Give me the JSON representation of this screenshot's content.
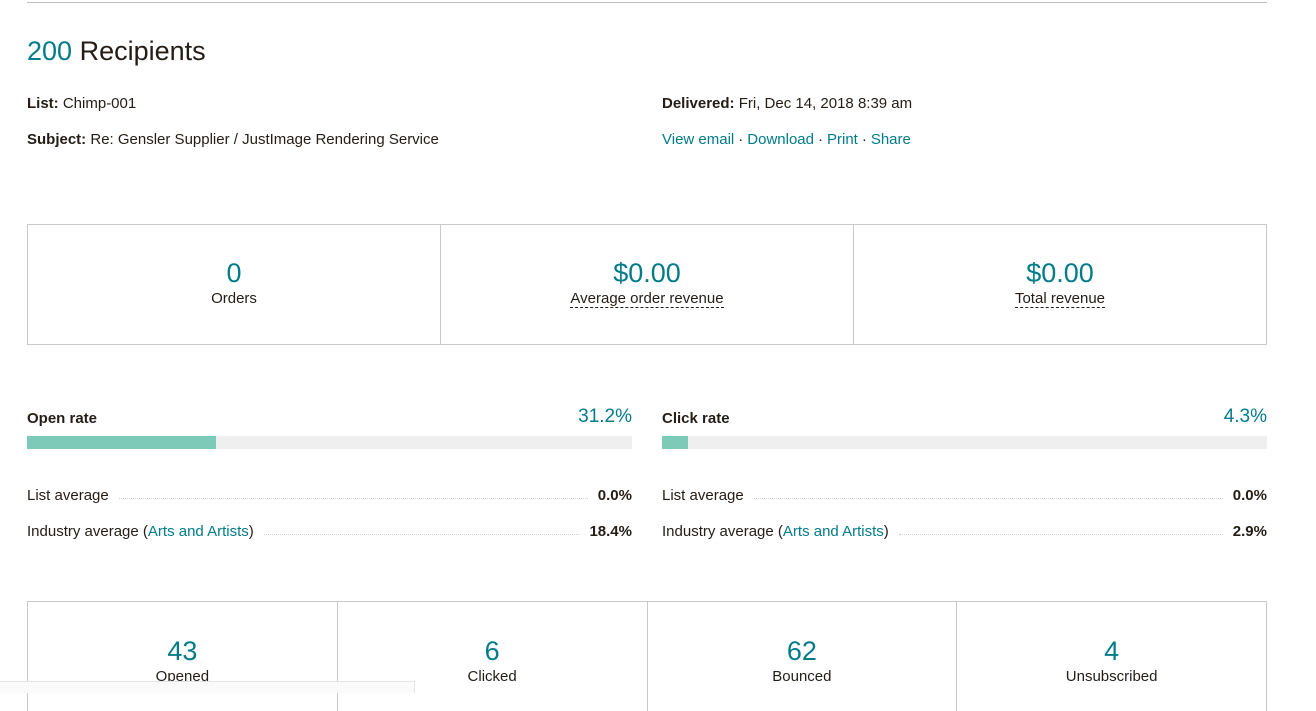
{
  "header": {
    "recipients_count": "200",
    "recipients_label": "Recipients"
  },
  "meta": {
    "list_label": "List:",
    "list_value": "Chimp-001",
    "subject_label": "Subject:",
    "subject_value": "Re: Gensler Supplier / JustImage Rendering Service",
    "delivered_label": "Delivered:",
    "delivered_value": "Fri, Dec 14, 2018 8:39 am",
    "links": [
      "View email",
      "Download",
      "Print",
      "Share"
    ],
    "link_separator": "·"
  },
  "revenue": [
    {
      "value": "0",
      "label": "Orders"
    },
    {
      "value": "$0.00",
      "label": "Average order revenue"
    },
    {
      "value": "$0.00",
      "label": "Total revenue"
    }
  ],
  "open_rate": {
    "label": "Open rate",
    "value": "31.2%",
    "fill_percent": 31.2,
    "list_average_label": "List average",
    "list_average_value": "0.0%",
    "industry_prefix": "Industry average (",
    "industry_name": "Arts and Artists",
    "industry_suffix": ")",
    "industry_value": "18.4%"
  },
  "click_rate": {
    "label": "Click rate",
    "value": "4.3%",
    "fill_percent": 4.3,
    "list_average_label": "List average",
    "list_average_value": "0.0%",
    "industry_prefix": "Industry average (",
    "industry_name": "Arts and Artists",
    "industry_suffix": ")",
    "industry_value": "2.9%"
  },
  "engagement": [
    {
      "value": "43",
      "label": "Opened"
    },
    {
      "value": "6",
      "label": "Clicked"
    },
    {
      "value": "62",
      "label": "Bounced"
    },
    {
      "value": "4",
      "label": "Unsubscribed"
    }
  ],
  "colors": {
    "accent": "#007c89",
    "bar_fill": "#7ecab8",
    "bar_track": "#efefef",
    "border": "#c9c9c9"
  }
}
